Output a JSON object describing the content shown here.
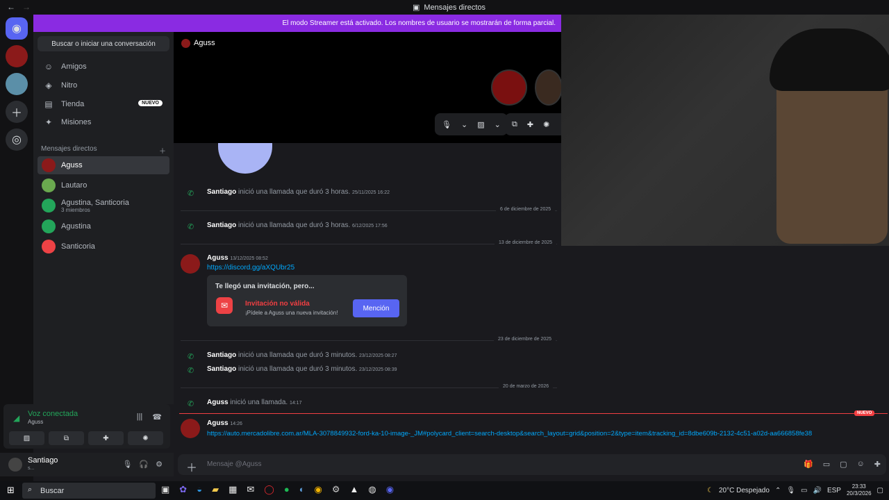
{
  "titlebar": {
    "title": "Mensajes directos"
  },
  "banner": {
    "text": "El modo Streamer está activado. Los nombres de usuario se mostrarán de forma parcial."
  },
  "sidebar": {
    "search_label": "Buscar o iniciar una conversación",
    "nav": [
      {
        "label": "Amigos",
        "icon": "friends-icon"
      },
      {
        "label": "Nitro",
        "icon": "nitro-icon"
      },
      {
        "label": "Tienda",
        "icon": "shop-icon",
        "badge": "NUEVO"
      },
      {
        "label": "Misiones",
        "icon": "quests-icon"
      }
    ],
    "dm_header": "Mensajes directos",
    "dms": [
      {
        "name": "Aguss",
        "active": true,
        "color": "#8b1a1a"
      },
      {
        "name": "Lautaro",
        "color": "#6aa84f"
      },
      {
        "name": "Agustina, Santicoria",
        "sub": "3 miembros",
        "color": "#23a55a"
      },
      {
        "name": "Agustina",
        "color": "#23a55a"
      },
      {
        "name": "Santicoria",
        "color": "#ed4245"
      }
    ]
  },
  "voice": {
    "status": "Voz conectada",
    "channel": "Aguss"
  },
  "user": {
    "name": "Santiago",
    "status": "s..."
  },
  "chat": {
    "header_name": "Aguss",
    "messages": [
      {
        "author": "Santiago",
        "text": "inició una llamada que duró 3 horas.",
        "time": "25/11/2025 16:22"
      },
      {
        "divider": "6 de diciembre de 2025"
      },
      {
        "author": "Santiago",
        "text": "inició una llamada que duró 3 horas.",
        "time": "6/12/2025 17:56"
      },
      {
        "divider": "13 de diciembre de 2025"
      },
      {
        "author": "Aguss",
        "time": "13/12/2025 08:52",
        "link": "https://discord.gg/aXQUbr25"
      },
      {
        "divider": "23 de diciembre de 2025"
      },
      {
        "author": "Santiago",
        "text": "inició una llamada que duró 3 minutos.",
        "time": "23/12/2025 08:27"
      },
      {
        "author": "Santiago",
        "text": "inició una llamada que duró 3 minutos.",
        "time": "23/12/2025 08:39"
      },
      {
        "divider": "20 de marzo de 2026"
      },
      {
        "author": "Aguss",
        "text": "inició una llamada.",
        "time": "14:17"
      }
    ],
    "invite": {
      "title": "Te llegó una invitación, pero...",
      "heading": "Invitación no válida",
      "sub": "¡Pídele a Aguss una nueva invitación!",
      "button": "Mención"
    },
    "new_badge": "NUEVO",
    "last": {
      "author": "Aguss",
      "time": "14:26",
      "link": "https://auto.mercadolibre.com.ar/MLA-3078849932-ford-ka-10-image-_JM#polycard_client=search-desktop&search_layout=grid&position=2&type=item&tracking_id=8dbe609b-2132-4c51-a02d-aa666858fe38"
    },
    "composer_placeholder": "Mensaje @Aguss"
  },
  "taskbar": {
    "search": "Buscar",
    "weather": "20°C  Despejado",
    "lang": "ESP",
    "time": "23:33",
    "date": "20/3/2026"
  }
}
